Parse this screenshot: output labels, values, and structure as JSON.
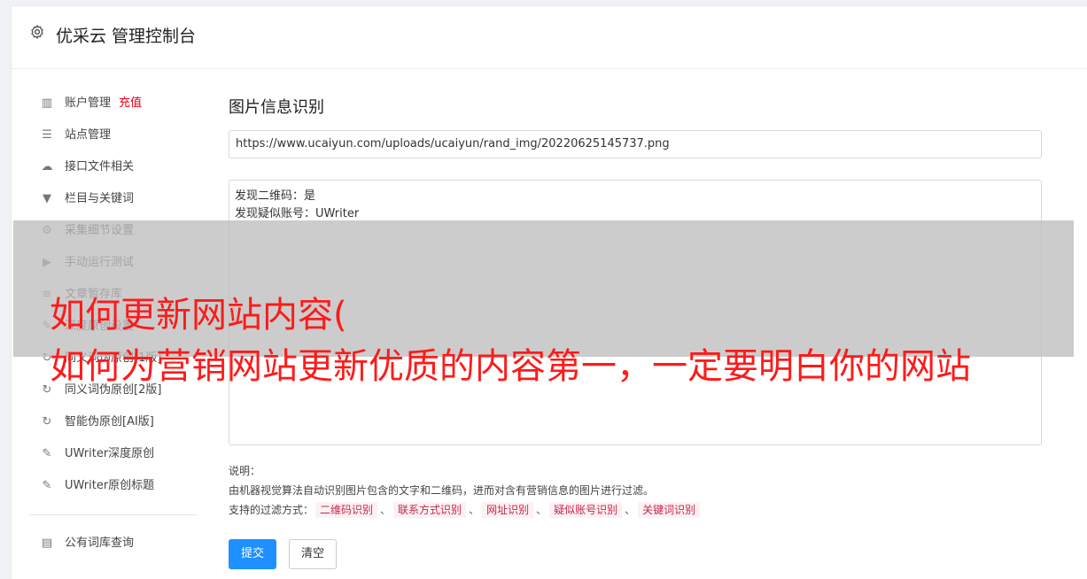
{
  "header": {
    "title": "优采云 管理控制台",
    "icon": "gear-icon"
  },
  "sidebar": {
    "items": [
      {
        "label": "账户管理",
        "extra": "充值",
        "icon": "bar-chart-icon",
        "glyph": "▥"
      },
      {
        "label": "站点管理",
        "icon": "server-icon",
        "glyph": "☰"
      },
      {
        "label": "接口文件相关",
        "icon": "cloud-upload-icon",
        "glyph": "☁"
      },
      {
        "label": "栏目与关键词",
        "icon": "filter-icon",
        "glyph": "▼"
      },
      {
        "label": "采集细节设置",
        "icon": "cogs-icon",
        "glyph": "⚙"
      },
      {
        "label": "手动运行测试",
        "icon": "play-circle-icon",
        "glyph": "▶"
      },
      {
        "label": "文章暂存库",
        "icon": "database-icon",
        "glyph": "≡"
      },
      {
        "label": "深度原创设置",
        "icon": "edit-icon",
        "glyph": "✎"
      },
      {
        "label": "同义词伪原创[1版]",
        "icon": "refresh-icon",
        "glyph": "↻"
      },
      {
        "label": "同义词伪原创[2版]",
        "icon": "refresh-icon",
        "glyph": "↻"
      },
      {
        "label": "智能伪原创[AI版]",
        "icon": "refresh-icon",
        "glyph": "↻"
      },
      {
        "label": "UWriter深度原创",
        "icon": "edit-icon",
        "glyph": "✎"
      },
      {
        "label": "UWriter原创标题",
        "icon": "edit-icon",
        "glyph": "✎"
      }
    ],
    "bottom_items": [
      {
        "label": "公有词库查询",
        "icon": "book-icon",
        "glyph": "▤"
      }
    ]
  },
  "main": {
    "title": "图片信息识别",
    "url_value": "https://www.ucaiyun.com/uploads/ucaiyun/rand_img/20220625145737.png",
    "result_lines": [
      "发现二维码：是",
      "发现疑似账号：UWriter"
    ],
    "notes": {
      "heading": "说明：",
      "description": "由机器视觉算法自动识别图片包含的文字和二维码，进而对含有营销信息的图片进行过滤。",
      "filters_label": "支持的过滤方式：",
      "filters": [
        "二维码识别",
        "联系方式识别",
        "网址识别",
        "疑似账号识别",
        "关键词识别"
      ],
      "separator": "、"
    },
    "submit_label": "提交",
    "clear_label": "清空"
  },
  "overlay": {
    "line1": "如何更新网站内容(",
    "line2": "如何为营销网站更新优质的内容第一，一定要明白你的网站"
  },
  "colors": {
    "accent": "#1e90ff",
    "recharge": "#e60012",
    "overlay_text": "#ff1a1a",
    "tag_text": "#c7254e"
  }
}
